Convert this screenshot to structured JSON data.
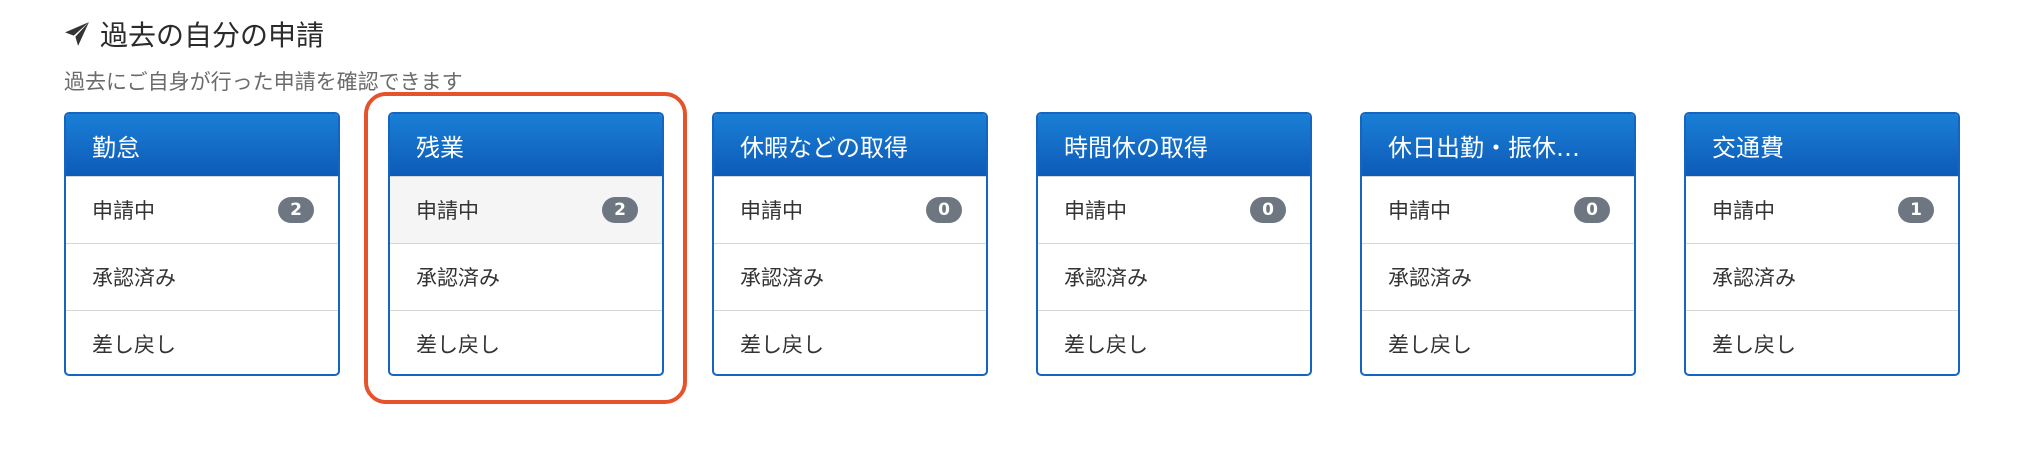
{
  "section": {
    "icon": "paper-plane-icon",
    "title": "過去の自分の申請",
    "description": "過去にご自身が行った申請を確認できます"
  },
  "panels": [
    {
      "title": "勤怠",
      "rows": [
        {
          "label": "申請中",
          "count": "2"
        },
        {
          "label": "承認済み",
          "count": ""
        },
        {
          "label": "差し戻し",
          "count": ""
        }
      ]
    },
    {
      "title": "残業",
      "highlighted": true,
      "rows": [
        {
          "label": "申請中",
          "count": "2"
        },
        {
          "label": "承認済み",
          "count": ""
        },
        {
          "label": "差し戻し",
          "count": ""
        }
      ]
    },
    {
      "title": "休暇などの取得",
      "rows": [
        {
          "label": "申請中",
          "count": "0"
        },
        {
          "label": "承認済み",
          "count": ""
        },
        {
          "label": "差し戻し",
          "count": ""
        }
      ]
    },
    {
      "title": "時間休の取得",
      "rows": [
        {
          "label": "申請中",
          "count": "0"
        },
        {
          "label": "承認済み",
          "count": ""
        },
        {
          "label": "差し戻し",
          "count": ""
        }
      ]
    },
    {
      "title": "休日出勤・振休…",
      "rows": [
        {
          "label": "申請中",
          "count": "0"
        },
        {
          "label": "承認済み",
          "count": ""
        },
        {
          "label": "差し戻し",
          "count": ""
        }
      ]
    },
    {
      "title": "交通費",
      "rows": [
        {
          "label": "申請中",
          "count": "1"
        },
        {
          "label": "承認済み",
          "count": ""
        },
        {
          "label": "差し戻し",
          "count": ""
        }
      ]
    }
  ],
  "colors": {
    "header_top": "#1a7fd6",
    "header_bottom": "#0d5bb8",
    "panel_border": "#1565c0",
    "badge": "#6e7781",
    "highlight_ring": "#e6522c"
  }
}
